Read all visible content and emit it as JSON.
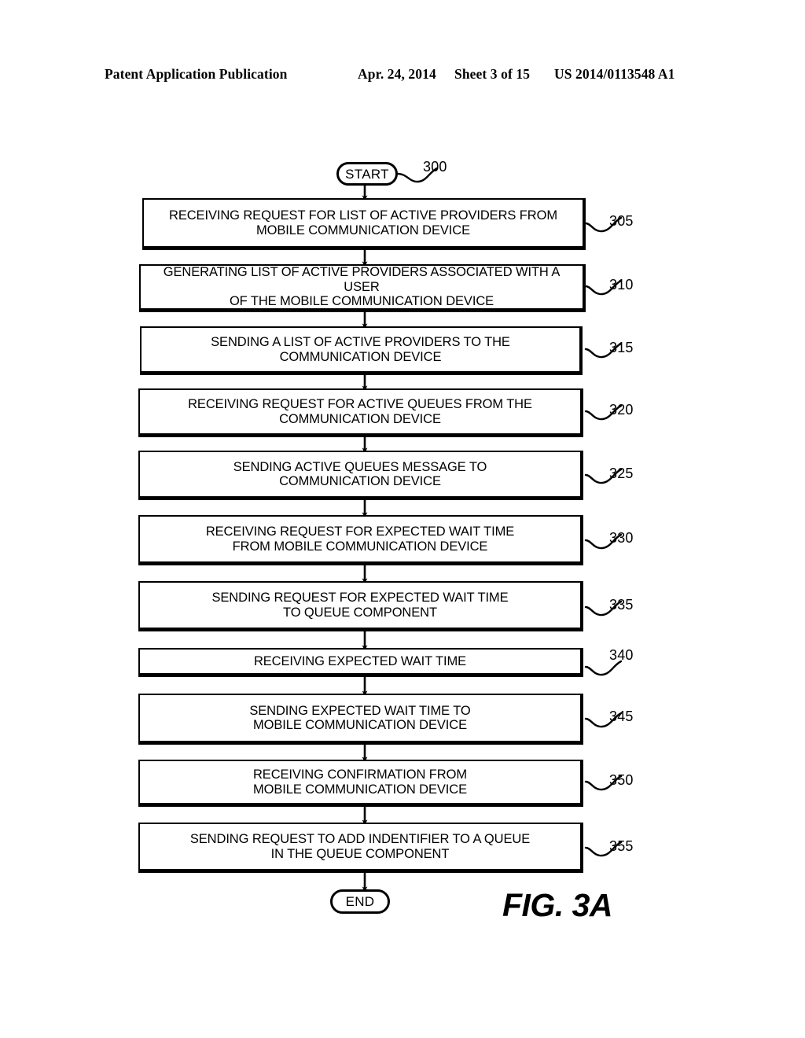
{
  "header": {
    "publication": "Patent Application Publication",
    "date": "Apr. 24, 2014",
    "sheet": "Sheet 3 of 15",
    "patent_number": "US 2014/0113548 A1"
  },
  "figure": {
    "caption": "FIG. 3A",
    "start_label": "START",
    "end_label": "END",
    "start_ref": "300",
    "nodes": [
      {
        "ref": "305",
        "text": "RECEIVING REQUEST FOR LIST OF ACTIVE PROVIDERS FROM\nMOBILE COMMUNICATION DEVICE"
      },
      {
        "ref": "310",
        "text": "GENERATING LIST OF ACTIVE PROVIDERS ASSOCIATED WITH A USER\nOF THE MOBILE COMMUNICATION DEVICE"
      },
      {
        "ref": "315",
        "text": "SENDING A LIST OF ACTIVE PROVIDERS TO THE\nCOMMUNICATION DEVICE"
      },
      {
        "ref": "320",
        "text": "RECEIVING REQUEST FOR ACTIVE QUEUES FROM THE\nCOMMUNICATION DEVICE"
      },
      {
        "ref": "325",
        "text": "SENDING ACTIVE QUEUES MESSAGE TO\nCOMMUNICATION DEVICE"
      },
      {
        "ref": "330",
        "text": "RECEIVING REQUEST FOR EXPECTED WAIT TIME\nFROM MOBILE COMMUNICATION DEVICE"
      },
      {
        "ref": "335",
        "text": "SENDING REQUEST FOR EXPECTED WAIT TIME\nTO QUEUE COMPONENT"
      },
      {
        "ref": "340",
        "text": "RECEIVING EXPECTED WAIT TIME"
      },
      {
        "ref": "345",
        "text": "SENDING EXPECTED WAIT TIME TO\nMOBILE COMMUNICATION DEVICE"
      },
      {
        "ref": "350",
        "text": "RECEIVING CONFIRMATION FROM\nMOBILE COMMUNICATION DEVICE"
      },
      {
        "ref": "355",
        "text": "SENDING REQUEST TO ADD INDENTIFIER TO A QUEUE\nIN THE QUEUE COMPONENT"
      }
    ]
  },
  "colors": {
    "ink": "#000000",
    "paper": "#ffffff"
  }
}
